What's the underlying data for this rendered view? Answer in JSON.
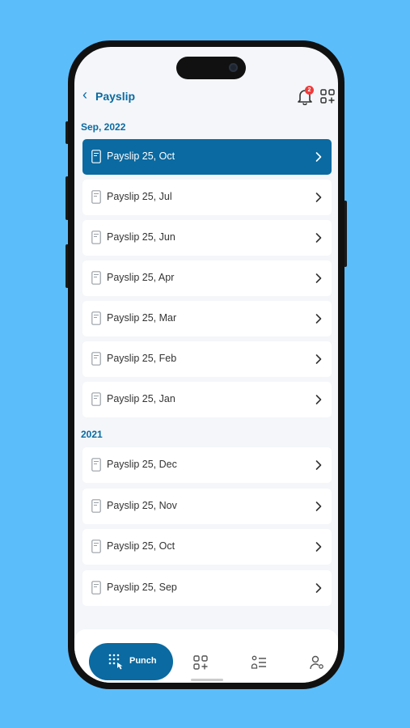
{
  "header": {
    "title": "Payslip",
    "notification_count": "2"
  },
  "sections": [
    {
      "label": "Sep, 2022",
      "items": [
        "Payslip 25, Oct",
        "Payslip 25, Jul",
        "Payslip 25, Jun",
        "Payslip 25, Apr",
        "Payslip 25, Mar",
        "Payslip 25, Feb",
        "Payslip 25, Jan"
      ]
    },
    {
      "label": "2021",
      "items": [
        "Payslip 25, Dec",
        "Payslip 25, Nov",
        "Payslip 25, Oct",
        "Payslip 25, Sep"
      ]
    }
  ],
  "nav": {
    "punch_label": "Punch"
  },
  "colors": {
    "primary": "#0a6aa1",
    "background": "#5cbdfb",
    "badge": "#ef3b3b"
  },
  "icons": [
    "back-arrow-icon",
    "bell-icon",
    "apps-grid-icon",
    "document-icon",
    "chevron-right-icon",
    "punch-keypad-icon",
    "apps-add-icon",
    "list-user-icon",
    "user-settings-icon"
  ]
}
